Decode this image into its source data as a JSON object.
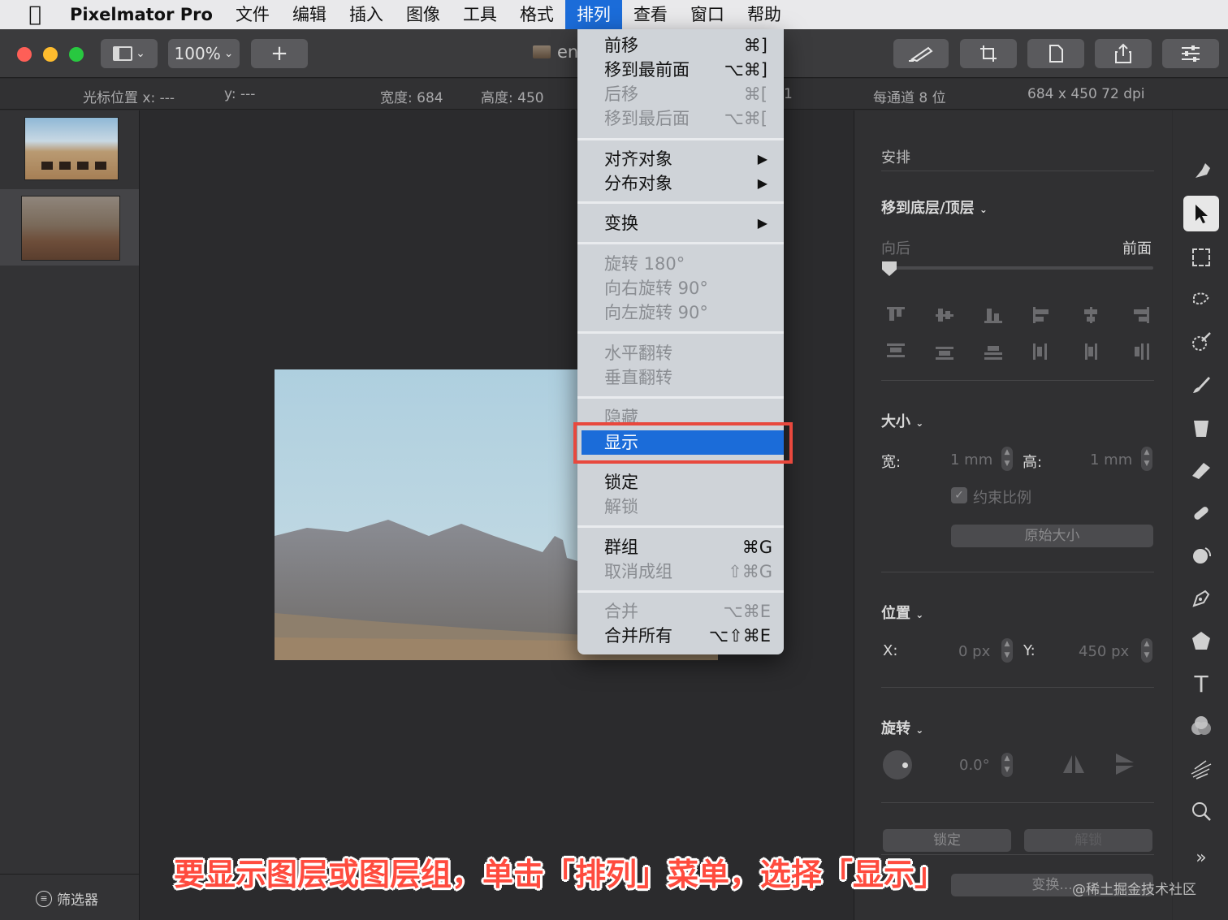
{
  "menubar": {
    "app_name": "Pixelmator Pro",
    "items": [
      "文件",
      "编辑",
      "插入",
      "图像",
      "工具",
      "格式",
      "排列",
      "查看",
      "窗口",
      "帮助"
    ],
    "active_item": "排列"
  },
  "toolbar": {
    "zoom": "100%",
    "add_label": "+",
    "doc_title": "en"
  },
  "infobar": {
    "cursor_x": "光标位置 x: ---",
    "cursor_y": "y: ---",
    "width": "宽度: 684",
    "height": "高度: 450",
    "channel": "每通道 8 位",
    "dims": "684 x 450 72 dpi",
    "hidden_fragment": "1"
  },
  "sidebar": {
    "filter_label": "筛选器"
  },
  "arrange_menu": {
    "items": [
      {
        "label": "前移",
        "shortcut": "⌘]",
        "disabled": false
      },
      {
        "label": "移到最前面",
        "shortcut": "⌥⌘]",
        "disabled": false
      },
      {
        "label": "后移",
        "shortcut": "⌘[",
        "disabled": true
      },
      {
        "label": "移到最后面",
        "shortcut": "⌥⌘[",
        "disabled": true
      },
      {
        "label": "对齐对象",
        "submenu": true
      },
      {
        "label": "分布对象",
        "submenu": true
      },
      {
        "label": "变换",
        "submenu": true
      },
      {
        "label": "旋转 180°",
        "disabled": true
      },
      {
        "label": "向右旋转 90°",
        "disabled": true
      },
      {
        "label": "向左旋转 90°",
        "disabled": true
      },
      {
        "label": "水平翻转",
        "disabled": true
      },
      {
        "label": "垂直翻转",
        "disabled": true
      },
      {
        "label": "隐藏",
        "disabled": true
      },
      {
        "label": "显示",
        "highlighted": true
      },
      {
        "label": "锁定",
        "disabled": false
      },
      {
        "label": "解锁",
        "disabled": true
      },
      {
        "label": "群组",
        "shortcut": "⌘G",
        "disabled": false
      },
      {
        "label": "取消成组",
        "shortcut": "⇧⌘G",
        "disabled": true
      },
      {
        "label": "合并",
        "shortcut": "⌥⌘E",
        "disabled": true
      },
      {
        "label": "合并所有",
        "shortcut": "⌥⇧⌘E",
        "disabled": false
      }
    ],
    "submenu_arrow": "▶"
  },
  "inspector": {
    "section_title": "安排",
    "arrange_title": "移到底层/顶层",
    "slider_left": "向后",
    "slider_right": "前面",
    "size_title": "大小",
    "width_label": "宽:",
    "width_value": "1 mm",
    "height_label": "高:",
    "height_value": "1 mm",
    "constrain_label": "约束比例",
    "original_size_button": "原始大小",
    "position_title": "位置",
    "x_label": "X:",
    "x_value": "0 px",
    "y_label": "Y:",
    "y_value": "450 px",
    "rotate_title": "旋转",
    "rotate_value": "0.0°",
    "lock_button": "锁定",
    "unlock_button": "解锁",
    "transform_button": "变换..."
  },
  "caption": "要显示图层或图层组，单击「排列」菜单，选择「显示」",
  "watermark": "@稀土掘金技术社区",
  "colors": {
    "accent": "#1b6cd9",
    "highlight_box": "#e8483d",
    "caption": "#ff4b3e"
  }
}
